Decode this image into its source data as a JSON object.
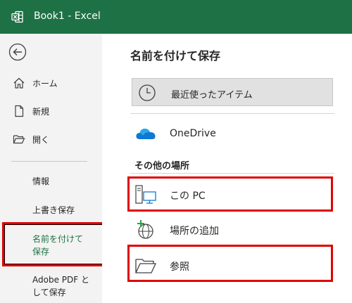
{
  "titlebar": {
    "app_title": "Book1 - Excel",
    "icon": "excel-logo-icon"
  },
  "sidebar": {
    "back_icon": "back-arrow-icon",
    "items": [
      {
        "label": "ホーム",
        "icon": "home-icon"
      },
      {
        "label": "新規",
        "icon": "new-document-icon"
      },
      {
        "label": "開く",
        "icon": "open-folder-icon"
      }
    ],
    "text_items": [
      {
        "label": "情報"
      },
      {
        "label": "上書き保存"
      },
      {
        "label": "名前を付けて\n保存",
        "line1": "名前を付けて",
        "line2": "保存"
      },
      {
        "label": "Adobe PDF と\nして保存",
        "line1": "Adobe PDF と",
        "line2": "して保存"
      }
    ]
  },
  "main": {
    "heading": "名前を付けて保存",
    "recent": {
      "label": "最近使ったアイテム",
      "icon": "clock-icon"
    },
    "onedrive": {
      "label": "OneDrive",
      "icon": "cloud-icon"
    },
    "other_places_label": "その他の場所",
    "locations": [
      {
        "label": "この PC",
        "icon": "computer-icon"
      },
      {
        "label": "場所の追加",
        "icon": "add-location-icon"
      },
      {
        "label": "参照",
        "icon": "folder-icon"
      }
    ]
  },
  "colors": {
    "excel_green": "#1e7145",
    "highlight_red": "#e00000",
    "onedrive_blue": "#0f78d4"
  }
}
